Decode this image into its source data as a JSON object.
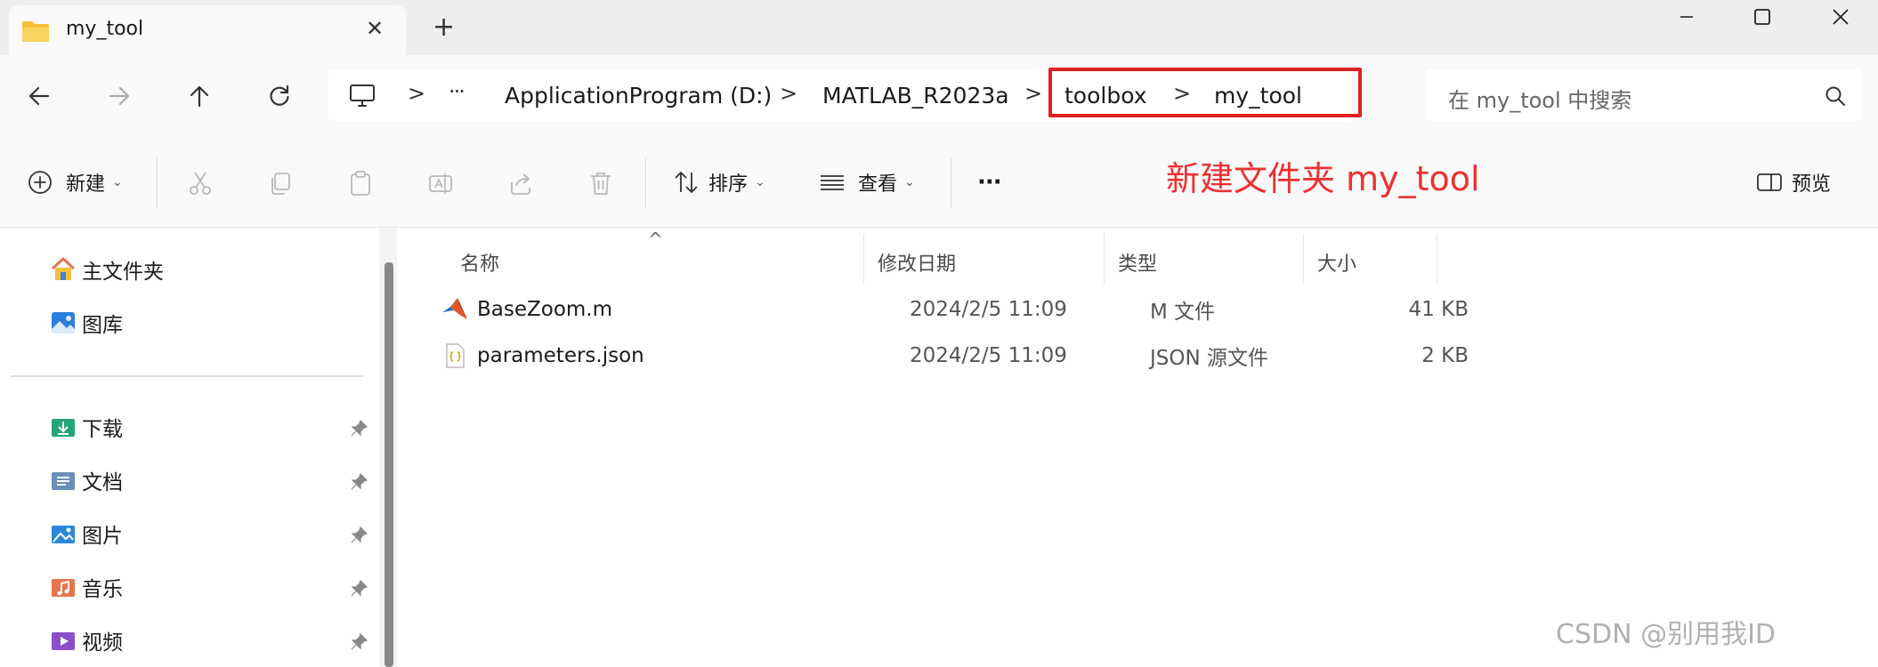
{
  "tab": {
    "title": "my_tool",
    "close_glyph": "✕",
    "new_tab_glyph": "+"
  },
  "window_controls": {
    "minimize_icon": "minimize-icon",
    "maximize_icon": "maximize-icon",
    "close_icon": "close-icon"
  },
  "nav": {
    "back_icon": "back-arrow-icon",
    "forward_icon": "forward-arrow-icon",
    "up_icon": "up-arrow-icon",
    "refresh_icon": "refresh-icon"
  },
  "breadcrumb": {
    "ellipsis": "···",
    "items": [
      "ApplicationProgram (D:)",
      "MATLAB_R2023a",
      "toolbox",
      "my_tool"
    ],
    "separator": ">"
  },
  "search": {
    "placeholder": "在 my_tool 中搜索"
  },
  "commands": {
    "new_label": "新建",
    "sort_label": "排序",
    "view_label": "查看",
    "more_label": "···",
    "preview_label": "预览",
    "caret": "⌄"
  },
  "annotation": {
    "text": "新建文件夹 my_tool",
    "color": "#ee3030"
  },
  "sidebar": {
    "items": [
      {
        "label": "主文件夹",
        "icon": "home-icon"
      },
      {
        "label": "图库",
        "icon": "gallery-icon"
      },
      {
        "label": "下载",
        "icon": "downloads-icon",
        "pinned": true
      },
      {
        "label": "文档",
        "icon": "documents-icon",
        "pinned": true
      },
      {
        "label": "图片",
        "icon": "pictures-icon",
        "pinned": true
      },
      {
        "label": "音乐",
        "icon": "music-icon",
        "pinned": true
      },
      {
        "label": "视频",
        "icon": "videos-icon",
        "pinned": true
      }
    ]
  },
  "files": {
    "columns": [
      "名称",
      "修改日期",
      "类型",
      "大小"
    ],
    "sort_indicator": "^",
    "rows": [
      {
        "name": "BaseZoom.m",
        "modified": "2024/2/5 11:09",
        "type": "M 文件",
        "size": "41 KB",
        "icon": "matlab-file-icon"
      },
      {
        "name": "parameters.json",
        "modified": "2024/2/5 11:09",
        "type": "JSON 源文件",
        "size": "2 KB",
        "icon": "json-file-icon"
      }
    ]
  },
  "watermark": "CSDN @别用我ID",
  "colors": {
    "accent": "#0067c0",
    "highlight_box": "#e02020",
    "folder": "#f3c03c"
  }
}
